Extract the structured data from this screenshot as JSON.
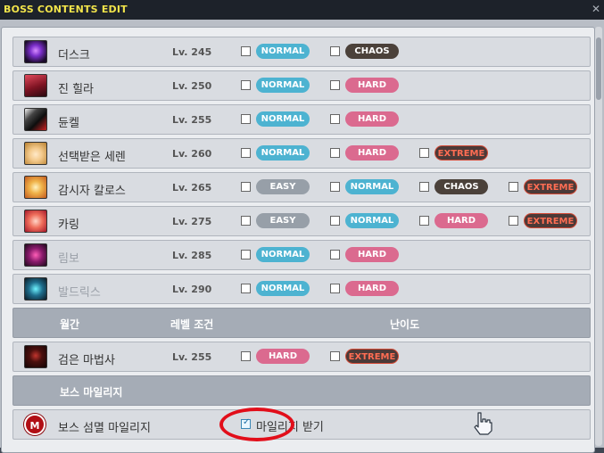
{
  "window": {
    "title": "BOSS CONTENTS EDIT",
    "close_glyph": "✕"
  },
  "bosses": [
    {
      "name": "더스크",
      "level": "Lv. 245",
      "difficulties": [
        "NORMAL",
        "CHAOS"
      ],
      "icon": "dusk-icon"
    },
    {
      "name": "진 힐라",
      "level": "Lv. 250",
      "difficulties": [
        "NORMAL",
        "HARD"
      ],
      "icon": "verus-hilla-icon"
    },
    {
      "name": "듄켈",
      "level": "Lv. 255",
      "difficulties": [
        "NORMAL",
        "HARD"
      ],
      "icon": "darknell-icon"
    },
    {
      "name": "선택받은 세렌",
      "level": "Lv. 260",
      "difficulties": [
        "NORMAL",
        "HARD",
        "EXTREME"
      ],
      "icon": "seren-icon"
    },
    {
      "name": "감시자 칼로스",
      "level": "Lv. 265",
      "difficulties": [
        "EASY",
        "NORMAL",
        "CHAOS",
        "EXTREME"
      ],
      "icon": "kalos-icon"
    },
    {
      "name": "카링",
      "level": "Lv. 275",
      "difficulties": [
        "EASY",
        "NORMAL",
        "HARD",
        "EXTREME"
      ],
      "icon": "kaling-icon"
    },
    {
      "name": "림보",
      "level": "Lv. 285",
      "difficulties": [
        "NORMAL",
        "HARD"
      ],
      "icon": "limbo-icon",
      "dim": true
    },
    {
      "name": "발드릭스",
      "level": "Lv. 290",
      "difficulties": [
        "NORMAL",
        "HARD"
      ],
      "icon": "baldrix-icon",
      "dim": true
    }
  ],
  "monthly_header": {
    "col1": "월간",
    "col2": "레벨 조건",
    "col3": "난이도"
  },
  "monthly_boss": {
    "name": "검은 마법사",
    "level": "Lv. 255",
    "difficulties": [
      "HARD",
      "EXTREME"
    ],
    "icon": "black-mage-icon"
  },
  "mileage_header": {
    "label": "보스 마일리지"
  },
  "mileage_row": {
    "name": "보스 섬멸 마일리지",
    "checkbox_label": "마일리지 받기",
    "checked": true,
    "icon_letter": "M"
  },
  "colors": {
    "normal": "#4db3d1",
    "hard": "#db6a8f",
    "easy": "#979fa8",
    "chaos": "#4b413a",
    "extreme_text": "#ff6d53",
    "title": "#f2e44a",
    "highlight": "#e20e1a"
  }
}
